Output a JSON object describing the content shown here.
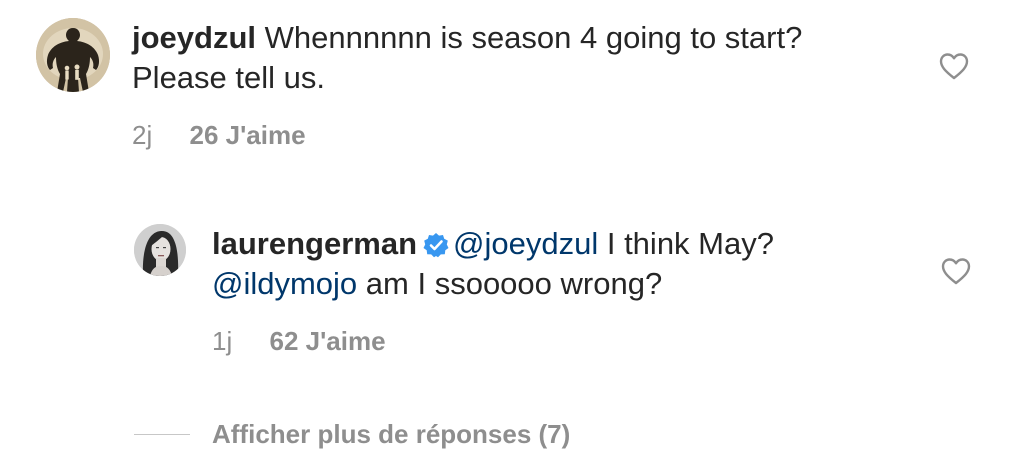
{
  "comments": [
    {
      "username": "joeydzul",
      "text": "Whennnnnn is season 4 going to start? Please tell us.",
      "time": "2j",
      "likes": "26 J'aime",
      "avatar_icon": "hulk-silhouette-avatar",
      "verified": false
    },
    {
      "username": "laurengerman",
      "mention1": "@joeydzul",
      "text1": " I think May? ",
      "mention2": "@ildymojo",
      "text2": " am I ssooooo wrong?",
      "time": "1j",
      "likes": "62 J'aime",
      "avatar_icon": "profile-photo-avatar",
      "verified": true
    }
  ],
  "view_more_replies": "Afficher plus de réponses (7)",
  "colors": {
    "mention": "#00376b",
    "muted": "#8e8e8e",
    "verified": "#3897f0",
    "text": "#262626"
  }
}
